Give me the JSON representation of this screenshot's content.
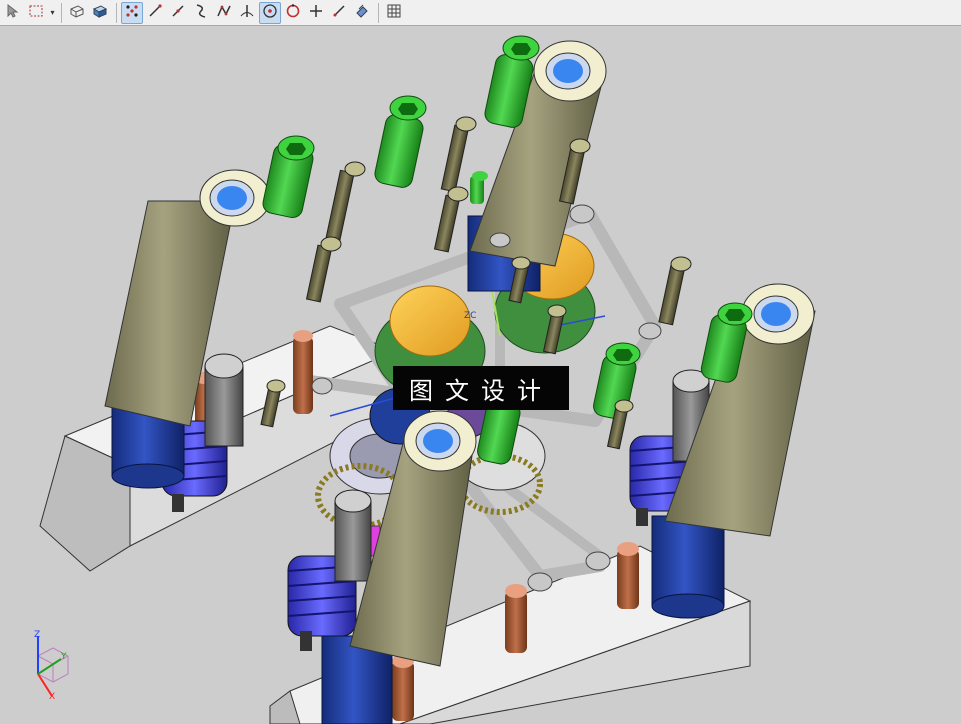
{
  "toolbar": {
    "buttons": [
      {
        "icon": "select-arrow-icon",
        "active": false
      },
      {
        "icon": "box-select-icon",
        "active": false
      },
      {
        "icon": "wireframe-view-icon",
        "active": false
      },
      {
        "icon": "shaded-view-icon",
        "active": false
      },
      {
        "icon": "snap-points-icon",
        "active": true
      },
      {
        "icon": "line-tool-icon",
        "active": false
      },
      {
        "icon": "line-tool-2-icon",
        "active": false
      },
      {
        "icon": "curve-tool-icon",
        "active": false
      },
      {
        "icon": "polyline-tool-icon",
        "active": false
      },
      {
        "icon": "normal-tool-icon",
        "active": false
      },
      {
        "icon": "center-point-icon",
        "active": true
      },
      {
        "icon": "circle-point-icon",
        "active": false
      },
      {
        "icon": "cross-point-icon",
        "active": false
      },
      {
        "icon": "slash-point-icon",
        "active": false
      },
      {
        "icon": "measure-icon",
        "active": false
      },
      {
        "icon": "grid-icon",
        "active": false
      }
    ]
  },
  "viewport": {
    "watermark_text": "图文设计",
    "origin_label": "ZC",
    "triad": {
      "z_label": "Z",
      "x_label": "X",
      "y_label": "Y"
    },
    "colors": {
      "background": "#cdcdcd",
      "cylinder_body": "#8a8866",
      "cylinder_base": "#1e3fa0",
      "spring": "#4848d8",
      "bolt_green": "#2fb52f",
      "disk_yellow": "#f4c040",
      "pin_copper": "#a0522d",
      "block": "#e2e2e2"
    }
  }
}
